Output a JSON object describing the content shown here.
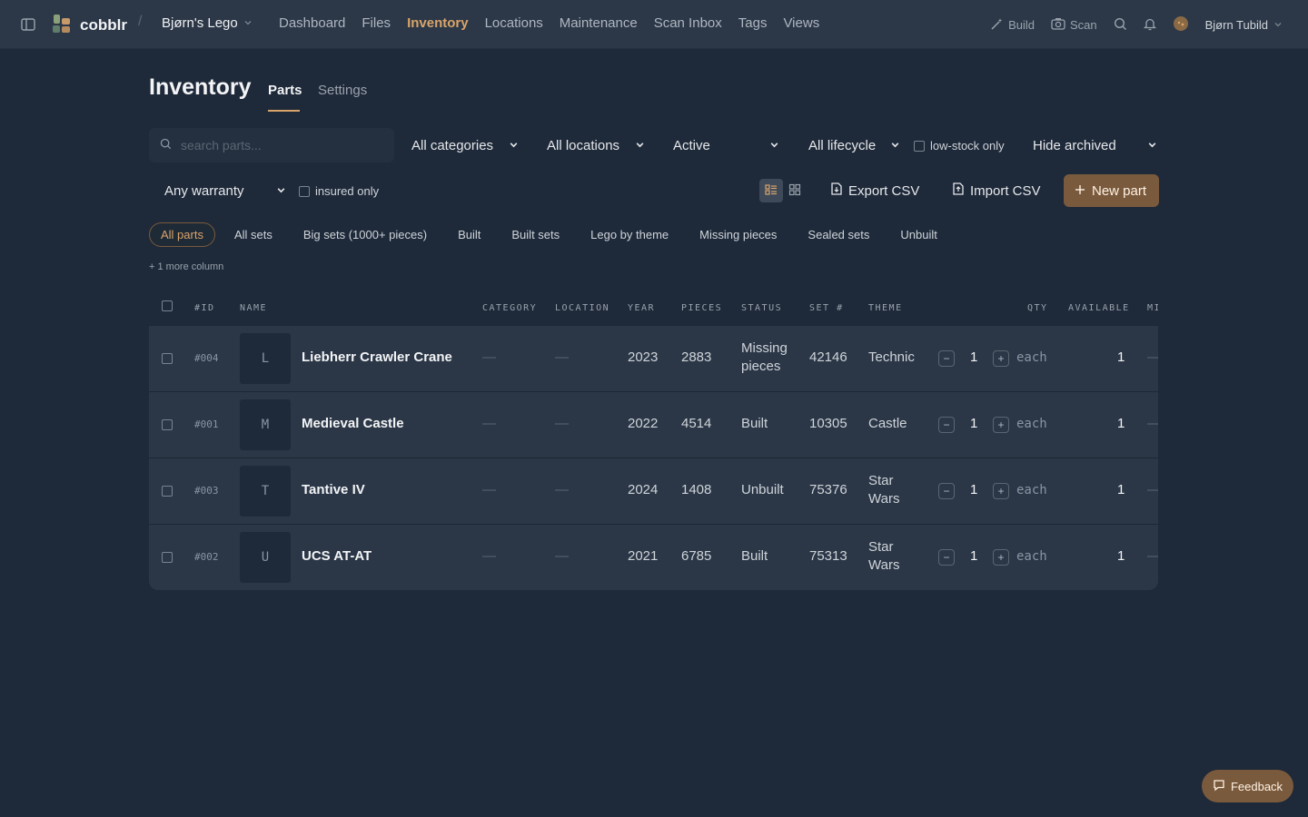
{
  "app": {
    "brand": "cobblr",
    "workspace": "Bjørn's Lego"
  },
  "nav": {
    "items": [
      {
        "label": "Dashboard"
      },
      {
        "label": "Files"
      },
      {
        "label": "Inventory",
        "active": true
      },
      {
        "label": "Locations"
      },
      {
        "label": "Maintenance"
      },
      {
        "label": "Scan Inbox"
      },
      {
        "label": "Tags"
      },
      {
        "label": "Views"
      }
    ]
  },
  "topbar": {
    "build_label": "Build",
    "scan_label": "Scan",
    "user_name": "Bjørn Tubild"
  },
  "page": {
    "title": "Inventory",
    "tabs": [
      {
        "label": "Parts",
        "active": true
      },
      {
        "label": "Settings"
      }
    ]
  },
  "filters": {
    "search_placeholder": "search parts...",
    "category": "All categories",
    "location": "All locations",
    "status": "Active",
    "lifecycle": "All lifecycle",
    "low_stock_label": "low-stock only",
    "archived": "Hide archived",
    "warranty": "Any warranty",
    "insured_label": "insured only"
  },
  "actions": {
    "export_label": "Export CSV",
    "import_label": "Import CSV",
    "new_label": "New part"
  },
  "views": {
    "chips": [
      {
        "label": "All parts",
        "active": true
      },
      {
        "label": "All sets"
      },
      {
        "label": "Big sets (1000+ pieces)"
      },
      {
        "label": "Built"
      },
      {
        "label": "Built sets"
      },
      {
        "label": "Lego by theme"
      },
      {
        "label": "Missing pieces"
      },
      {
        "label": "Sealed sets"
      },
      {
        "label": "Unbuilt"
      }
    ],
    "more_columns": "+ 1 more column"
  },
  "table": {
    "headers": {
      "id": "#ID",
      "name": "NAME",
      "category": "CATEGORY",
      "location": "LOCATION",
      "year": "YEAR",
      "pieces": "PIECES",
      "status": "STATUS",
      "set": "SET #",
      "theme": "THEME",
      "qty": "QTY",
      "available": "AVAILABLE",
      "mi": "MI"
    },
    "rows": [
      {
        "id": "#004",
        "initial": "L",
        "name": "Liebherr Crawler Crane",
        "category": "—",
        "location": "—",
        "year": "2023",
        "pieces": "2883",
        "status_l1": "Missing",
        "status_l2": "pieces",
        "set": "42146",
        "theme_l1": "Technic",
        "theme_l2": "",
        "qty": "1",
        "unit": "each",
        "available": "1",
        "mi": "—"
      },
      {
        "id": "#001",
        "initial": "M",
        "name": "Medieval Castle",
        "category": "—",
        "location": "—",
        "year": "2022",
        "pieces": "4514",
        "status_l1": "Built",
        "status_l2": "",
        "set": "10305",
        "theme_l1": "Castle",
        "theme_l2": "",
        "qty": "1",
        "unit": "each",
        "available": "1",
        "mi": "—"
      },
      {
        "id": "#003",
        "initial": "T",
        "name": "Tantive IV",
        "category": "—",
        "location": "—",
        "year": "2024",
        "pieces": "1408",
        "status_l1": "Unbuilt",
        "status_l2": "",
        "set": "75376",
        "theme_l1": "Star",
        "theme_l2": "Wars",
        "qty": "1",
        "unit": "each",
        "available": "1",
        "mi": "—"
      },
      {
        "id": "#002",
        "initial": "U",
        "name": "UCS AT-AT",
        "category": "—",
        "location": "—",
        "year": "2021",
        "pieces": "6785",
        "status_l1": "Built",
        "status_l2": "",
        "set": "75313",
        "theme_l1": "Star",
        "theme_l2": "Wars",
        "qty": "1",
        "unit": "each",
        "available": "1",
        "mi": "—"
      }
    ]
  },
  "feedback": {
    "label": "Feedback"
  },
  "colors": {
    "background": "#1e2939",
    "topbar": "#2c3848",
    "accent": "#d9a46a",
    "primary_button": "#7a5a3d",
    "row": "#2b3747"
  }
}
